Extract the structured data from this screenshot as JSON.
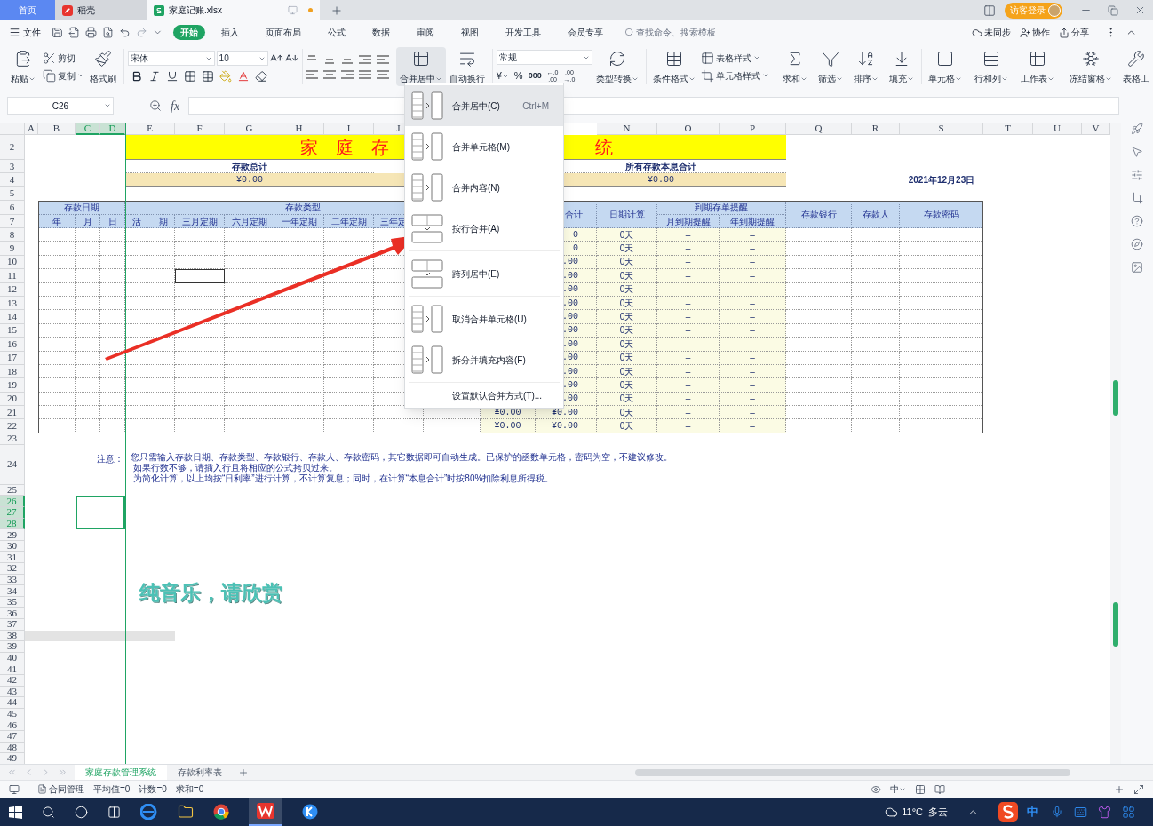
{
  "title_bar": {
    "tabs": [
      {
        "kind": "home",
        "label": "首页",
        "selected": false
      },
      {
        "kind": "docer",
        "label": "稻壳",
        "selected": false
      },
      {
        "kind": "workbook",
        "label": "家庭记账.xlsx",
        "selected": true,
        "unsaved": true
      }
    ],
    "login": "访客登录"
  },
  "menu_bar": {
    "file": "文件",
    "tabs": [
      {
        "label": "开始",
        "selected": true
      },
      {
        "label": "插入",
        "selected": false
      },
      {
        "label": "页面布局",
        "selected": false
      },
      {
        "label": "公式",
        "selected": false
      },
      {
        "label": "数据",
        "selected": false
      },
      {
        "label": "审阅",
        "selected": false
      },
      {
        "label": "视图",
        "selected": false
      },
      {
        "label": "开发工具",
        "selected": false
      },
      {
        "label": "会员专享",
        "selected": false
      }
    ],
    "search": {
      "placeholder": "查找命令、搜索模板"
    },
    "actions": [
      "未同步",
      "协作",
      "分享"
    ]
  },
  "ribbon": {
    "paste": "粘贴",
    "cut": "剪切",
    "copy": "复制",
    "format_painter": "格式刷",
    "font": "宋体",
    "font_size": "10",
    "merge": {
      "label": "合并居中",
      "open": true
    },
    "wrap": "自动换行",
    "number_format": "常规",
    "currency": "¥",
    "percent": "%",
    "thousands": "000",
    "decimals": [
      [
        "←.0",
        ".00"
      ],
      [
        ".00",
        "→.0"
      ]
    ],
    "convert": "类型转换",
    "conditional": "条件格式",
    "table_style": "表格样式",
    "cell_style": "单元格样式",
    "tools": [
      {
        "label": "求和"
      },
      {
        "label": "筛选"
      },
      {
        "label": "排序"
      },
      {
        "label": "填充"
      },
      {
        "label": "单元格"
      },
      {
        "label": "行和列"
      },
      {
        "label": "工作表"
      },
      {
        "label": "冻结窗格"
      },
      {
        "label": "表格工"
      }
    ]
  },
  "formula_bar": {
    "name_box": "C26",
    "function_label": "fx"
  },
  "sheet": {
    "columns_left": [
      {
        "label": "A",
        "selected": false
      },
      {
        "label": "B",
        "selected": false
      },
      {
        "label": "C",
        "selected": true
      },
      {
        "label": "D",
        "selected": true
      },
      {
        "label": "E",
        "selected": false
      },
      {
        "label": "F",
        "selected": false
      },
      {
        "label": "G",
        "selected": false
      },
      {
        "label": "H",
        "selected": false
      },
      {
        "label": "I",
        "selected": false
      },
      {
        "label": "J",
        "selected": false
      }
    ],
    "columns_right": [
      {
        "label": "N",
        "selected": false
      },
      {
        "label": "O",
        "selected": false
      },
      {
        "label": "P",
        "selected": false
      },
      {
        "label": "Q",
        "selected": false
      },
      {
        "label": "R",
        "selected": false
      },
      {
        "label": "S",
        "selected": false
      },
      {
        "label": "T",
        "selected": false
      },
      {
        "label": "U",
        "selected": false
      },
      {
        "label": "V",
        "selected": false
      }
    ],
    "rows": [
      {
        "label": "2",
        "selected": false
      },
      {
        "label": "3",
        "selected": false
      },
      {
        "label": "4",
        "selected": false
      },
      {
        "label": "5",
        "selected": false
      },
      {
        "label": "6",
        "selected": false
      },
      {
        "label": "7",
        "selected": false
      },
      {
        "label": "8",
        "selected": false
      },
      {
        "label": "9",
        "selected": false
      },
      {
        "label": "10",
        "selected": false
      },
      {
        "label": "11",
        "selected": false
      },
      {
        "label": "12",
        "selected": false
      },
      {
        "label": "13",
        "selected": false
      },
      {
        "label": "14",
        "selected": false
      },
      {
        "label": "15",
        "selected": false
      },
      {
        "label": "16",
        "selected": false
      },
      {
        "label": "17",
        "selected": false
      },
      {
        "label": "18",
        "selected": false
      },
      {
        "label": "19",
        "selected": false
      },
      {
        "label": "20",
        "selected": false
      },
      {
        "label": "21",
        "selected": false
      },
      {
        "label": "22",
        "selected": false
      },
      {
        "label": "23",
        "selected": false
      },
      {
        "label": "24",
        "selected": false
      },
      {
        "label": "25",
        "selected": false
      },
      {
        "label": "26",
        "selected": true
      },
      {
        "label": "27",
        "selected": true
      },
      {
        "label": "28",
        "selected": true
      },
      {
        "label": "29",
        "selected": false
      },
      {
        "label": "30",
        "selected": false
      },
      {
        "label": "31",
        "selected": false
      },
      {
        "label": "32",
        "selected": false
      },
      {
        "label": "33",
        "selected": false
      },
      {
        "label": "34",
        "selected": false
      },
      {
        "label": "35",
        "selected": false
      },
      {
        "label": "36",
        "selected": false
      },
      {
        "label": "37",
        "selected": false
      },
      {
        "label": "38",
        "selected": false
      },
      {
        "label": "39",
        "selected": false
      },
      {
        "label": "40",
        "selected": false
      },
      {
        "label": "41",
        "selected": false
      },
      {
        "label": "42",
        "selected": false
      },
      {
        "label": "43",
        "selected": false
      },
      {
        "label": "44",
        "selected": false
      },
      {
        "label": "45",
        "selected": false
      },
      {
        "label": "46",
        "selected": false
      },
      {
        "label": "47",
        "selected": false
      },
      {
        "label": "48",
        "selected": false
      },
      {
        "label": "49",
        "selected": false
      }
    ],
    "title": {
      "left": "家　庭　存",
      "right": "统"
    },
    "summaries": [
      {
        "label": "存款总计",
        "value": "¥0.00"
      },
      {
        "label": "所有存款本息合计",
        "value": "¥0.00"
      }
    ],
    "date": "2021年12月23日",
    "header": {
      "date_group": "存款日期",
      "date_parts": [
        "年",
        "月",
        "日"
      ],
      "type_group": "存款类型",
      "types": [
        "活　　期",
        "三月定期",
        "六月定期",
        "一年定期",
        "二年定期",
        "三年定"
      ],
      "total": "合计",
      "days": "日期计算",
      "reminder_group": "到期存单提醒",
      "reminders": [
        "月到期提醒",
        "年到期提醒"
      ],
      "bank": "存款银行",
      "depositor": "存款人",
      "password": "存款密码"
    },
    "data_rows": [
      {
        "total": "0",
        "days": "0天",
        "monthly": "–",
        "yearly": "–"
      },
      {
        "total": "0",
        "days": "0天",
        "monthly": "–",
        "yearly": "–"
      },
      {
        "total": ".00",
        "days": "0天",
        "monthly": "–",
        "yearly": "–"
      },
      {
        "total": ".00",
        "days": "0天",
        "monthly": "–",
        "yearly": "–"
      },
      {
        "total": ".00",
        "days": "0天",
        "monthly": "–",
        "yearly": "–"
      },
      {
        "total": ".00",
        "days": "0天",
        "monthly": "–",
        "yearly": "–"
      },
      {
        "total": ".00",
        "days": "0天",
        "monthly": "–",
        "yearly": "–"
      },
      {
        "total": ".00",
        "days": "0天",
        "monthly": "–",
        "yearly": "–"
      },
      {
        "total": ".00",
        "days": "0天",
        "monthly": "–",
        "yearly": "–"
      },
      {
        "total": ".00",
        "days": "0天",
        "monthly": "–",
        "yearly": "–"
      },
      {
        "total": ".00",
        "days": "0天",
        "monthly": "–",
        "yearly": "–"
      },
      {
        "total": ".00",
        "days": "0天",
        "monthly": "–",
        "yearly": "–"
      },
      {
        "total": ".00",
        "days": "0天",
        "monthly": "–",
        "yearly": "–"
      },
      {
        "principal": "¥0.00",
        "total": "¥0.00",
        "days": "0天",
        "monthly": "–",
        "yearly": "–"
      },
      {
        "principal": "¥0.00",
        "total": "¥0.00",
        "days": "0天",
        "monthly": "–",
        "yearly": "–"
      }
    ],
    "note": {
      "label": "注意：",
      "lines": [
        "您只需输入存款日期、存款类型、存款银行、存款人、存款密码，其它数据即可自动生成。已保护的函数单元格，密码为空，不建议修改。",
        "如果行数不够，请插入行且将相应的公式拷贝过来。",
        "为简化计算，以上均按“日利率”进行计算，不计算复息；同时，在计算“本息合计”时按80%扣除利息所得税。"
      ]
    }
  },
  "merge_menu": [
    {
      "kind": "merge",
      "label": "合并居中(C)",
      "shortcut": "Ctrl+M",
      "selected": true
    },
    {
      "kind": "merge",
      "label": "合并单元格(M)",
      "selected": false
    },
    {
      "kind": "merge",
      "label": "合并内容(N)",
      "selected": false
    },
    {
      "kind": "merge",
      "label": "按行合并(A)",
      "selected": false
    },
    {
      "kind": "merge",
      "label": "跨列居中(E)",
      "selected": false
    },
    {
      "kind": "merge",
      "label": "取消合并单元格(U)",
      "selected": false
    },
    {
      "kind": "merge",
      "label": "拆分并填充内容(F)",
      "selected": false
    },
    {
      "kind": "setting",
      "label": "设置默认合并方式(T)...",
      "selected": false
    }
  ],
  "caption": "纯音乐，请欣赏",
  "sheet_tabs": [
    {
      "label": "家庭存款管理系统",
      "selected": true
    },
    {
      "label": "存款利率表",
      "selected": false
    }
  ],
  "status_bar": {
    "contract": "合同管理",
    "stats": [
      "平均值=0",
      "计数=0",
      "求和=0"
    ],
    "input_mode": "中"
  },
  "taskbar": {
    "temperature": "11°C",
    "condition": "多云",
    "ime": "中"
  }
}
